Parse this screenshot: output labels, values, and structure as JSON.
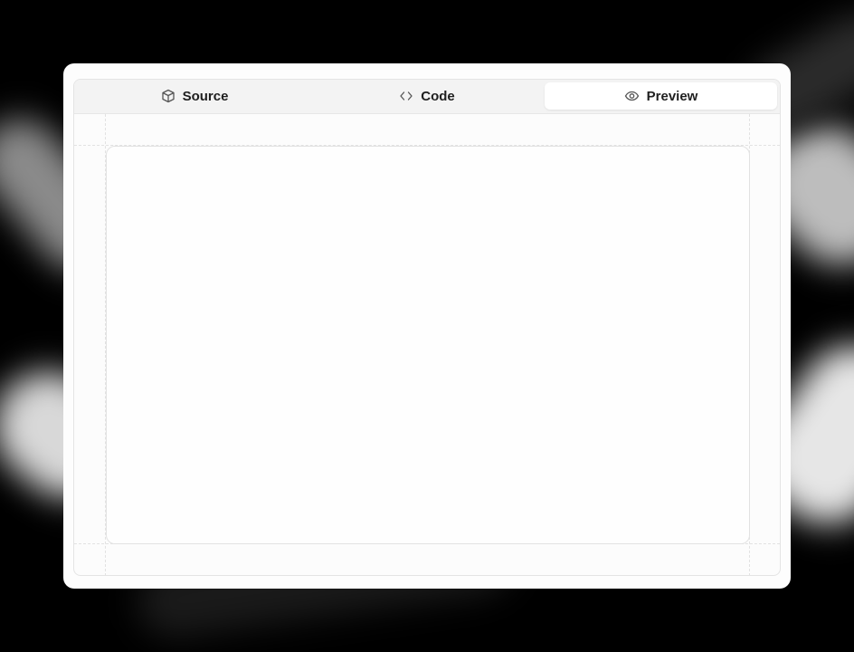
{
  "tabs": [
    {
      "label": "Source",
      "icon": "cube-icon",
      "active": false
    },
    {
      "label": "Code",
      "icon": "code-icon",
      "active": false
    },
    {
      "label": "Preview",
      "icon": "eye-icon",
      "active": true
    }
  ],
  "colors": {
    "active_tab_bg": "#ffffff",
    "tabbar_bg": "#f3f3f3",
    "card_bg": "#fdfdfd"
  }
}
